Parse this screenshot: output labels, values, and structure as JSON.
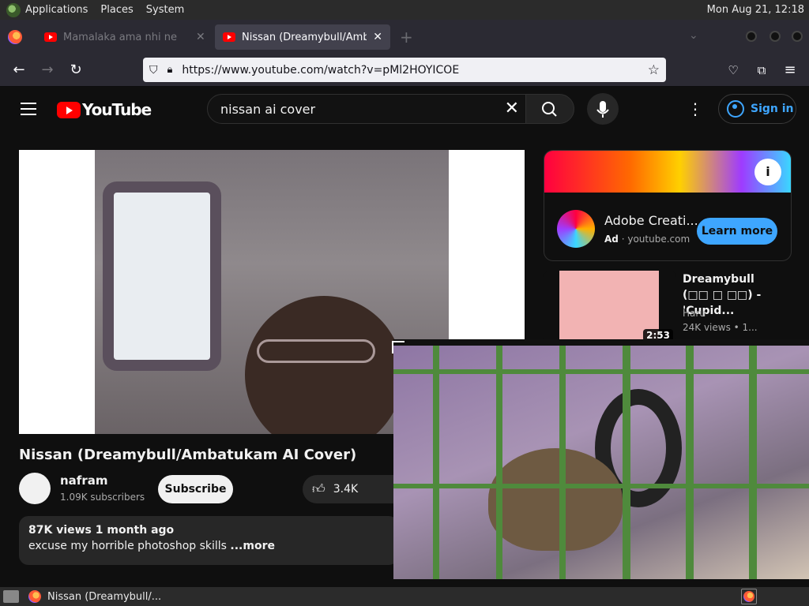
{
  "top_panel": {
    "menus": [
      "Applications",
      "Places",
      "System"
    ],
    "clock": "Mon Aug 21, 12:18"
  },
  "browser": {
    "tabs": [
      {
        "label": "Mamalaka ama nhi ne",
        "active": false
      },
      {
        "label": "Nissan (Dreamybull/Ambatu",
        "active": true
      }
    ],
    "url": "https://www.youtube.com/watch?v=pMl2HOYICOE"
  },
  "youtube": {
    "logo_text": "YouTube",
    "search_query": "nissan ai cover",
    "signin_label": "Sign in",
    "video": {
      "title": "Nissan (Dreamybull/Ambatukam AI Cover)",
      "channel": "nafram",
      "subscribers": "1.09K subscribers",
      "subscribe_label": "Subscribe",
      "likes": "3.4K",
      "views_date": "87K views  1 month ago",
      "description": "excuse my horrible photoshop skills",
      "more_label": "...more"
    },
    "ad": {
      "title": "Adobe Creati...",
      "badge": "Ad",
      "domain": "youtube.com",
      "cta": "Learn more"
    },
    "recommendation": {
      "title": "Dreamybull (□□ □ □□) - 'Cupid...",
      "channel": "Haru",
      "views": "24K views  • 1...",
      "duration": "2:53"
    }
  },
  "taskbar": {
    "task_label": "Nissan (Dreamybull/..."
  }
}
